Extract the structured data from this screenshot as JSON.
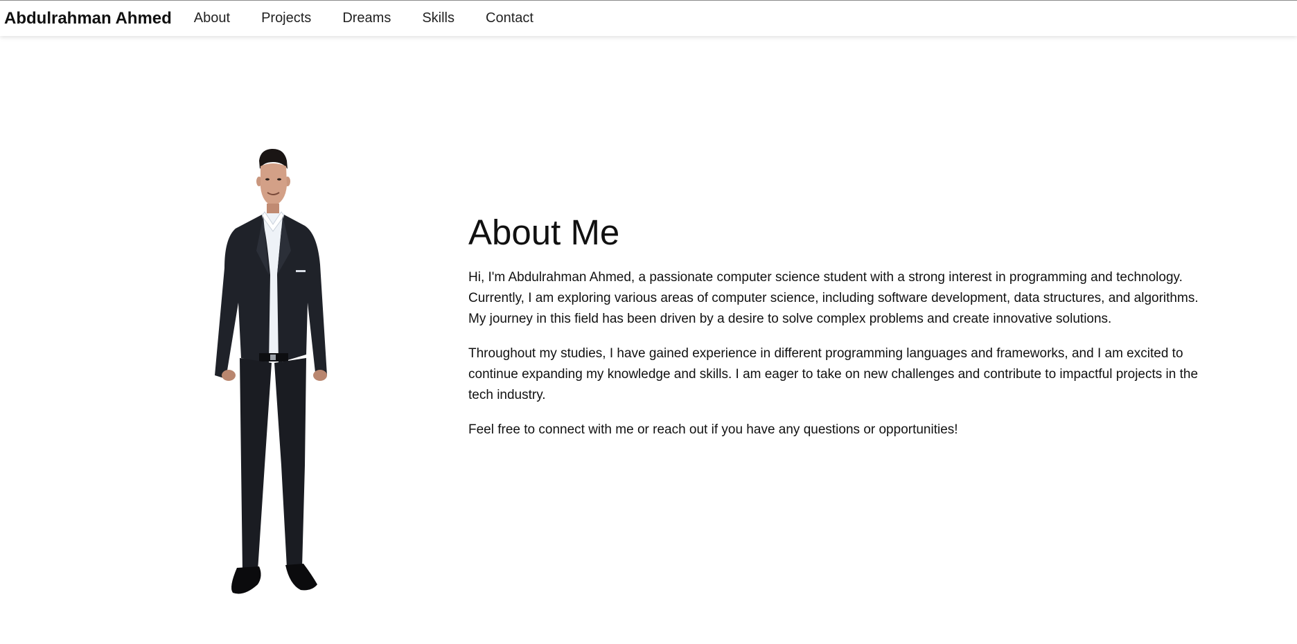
{
  "nav": {
    "brand": "Abdulrahman Ahmed",
    "links": [
      {
        "label": "About"
      },
      {
        "label": "Projects"
      },
      {
        "label": "Dreams"
      },
      {
        "label": "Skills"
      },
      {
        "label": "Contact"
      }
    ]
  },
  "about": {
    "title": "About Me",
    "paragraphs": [
      "Hi, I'm Abdulrahman Ahmed, a passionate computer science student with a strong interest in programming and technology. Currently, I am exploring various areas of computer science, including software development, data structures, and algorithms. My journey in this field has been driven by a desire to solve complex problems and create innovative solutions.",
      "Throughout my studies, I have gained experience in different programming languages and frameworks, and I am excited to continue expanding my knowledge and skills. I am eager to take on new challenges and contribute to impactful projects in the tech industry.",
      "Feel free to connect with me or reach out if you have any questions or opportunities!"
    ]
  },
  "colors": {
    "suit": "#1f2229",
    "shirt": "#eef2f7",
    "skin": "#c9967d",
    "hair": "#1a1514"
  }
}
